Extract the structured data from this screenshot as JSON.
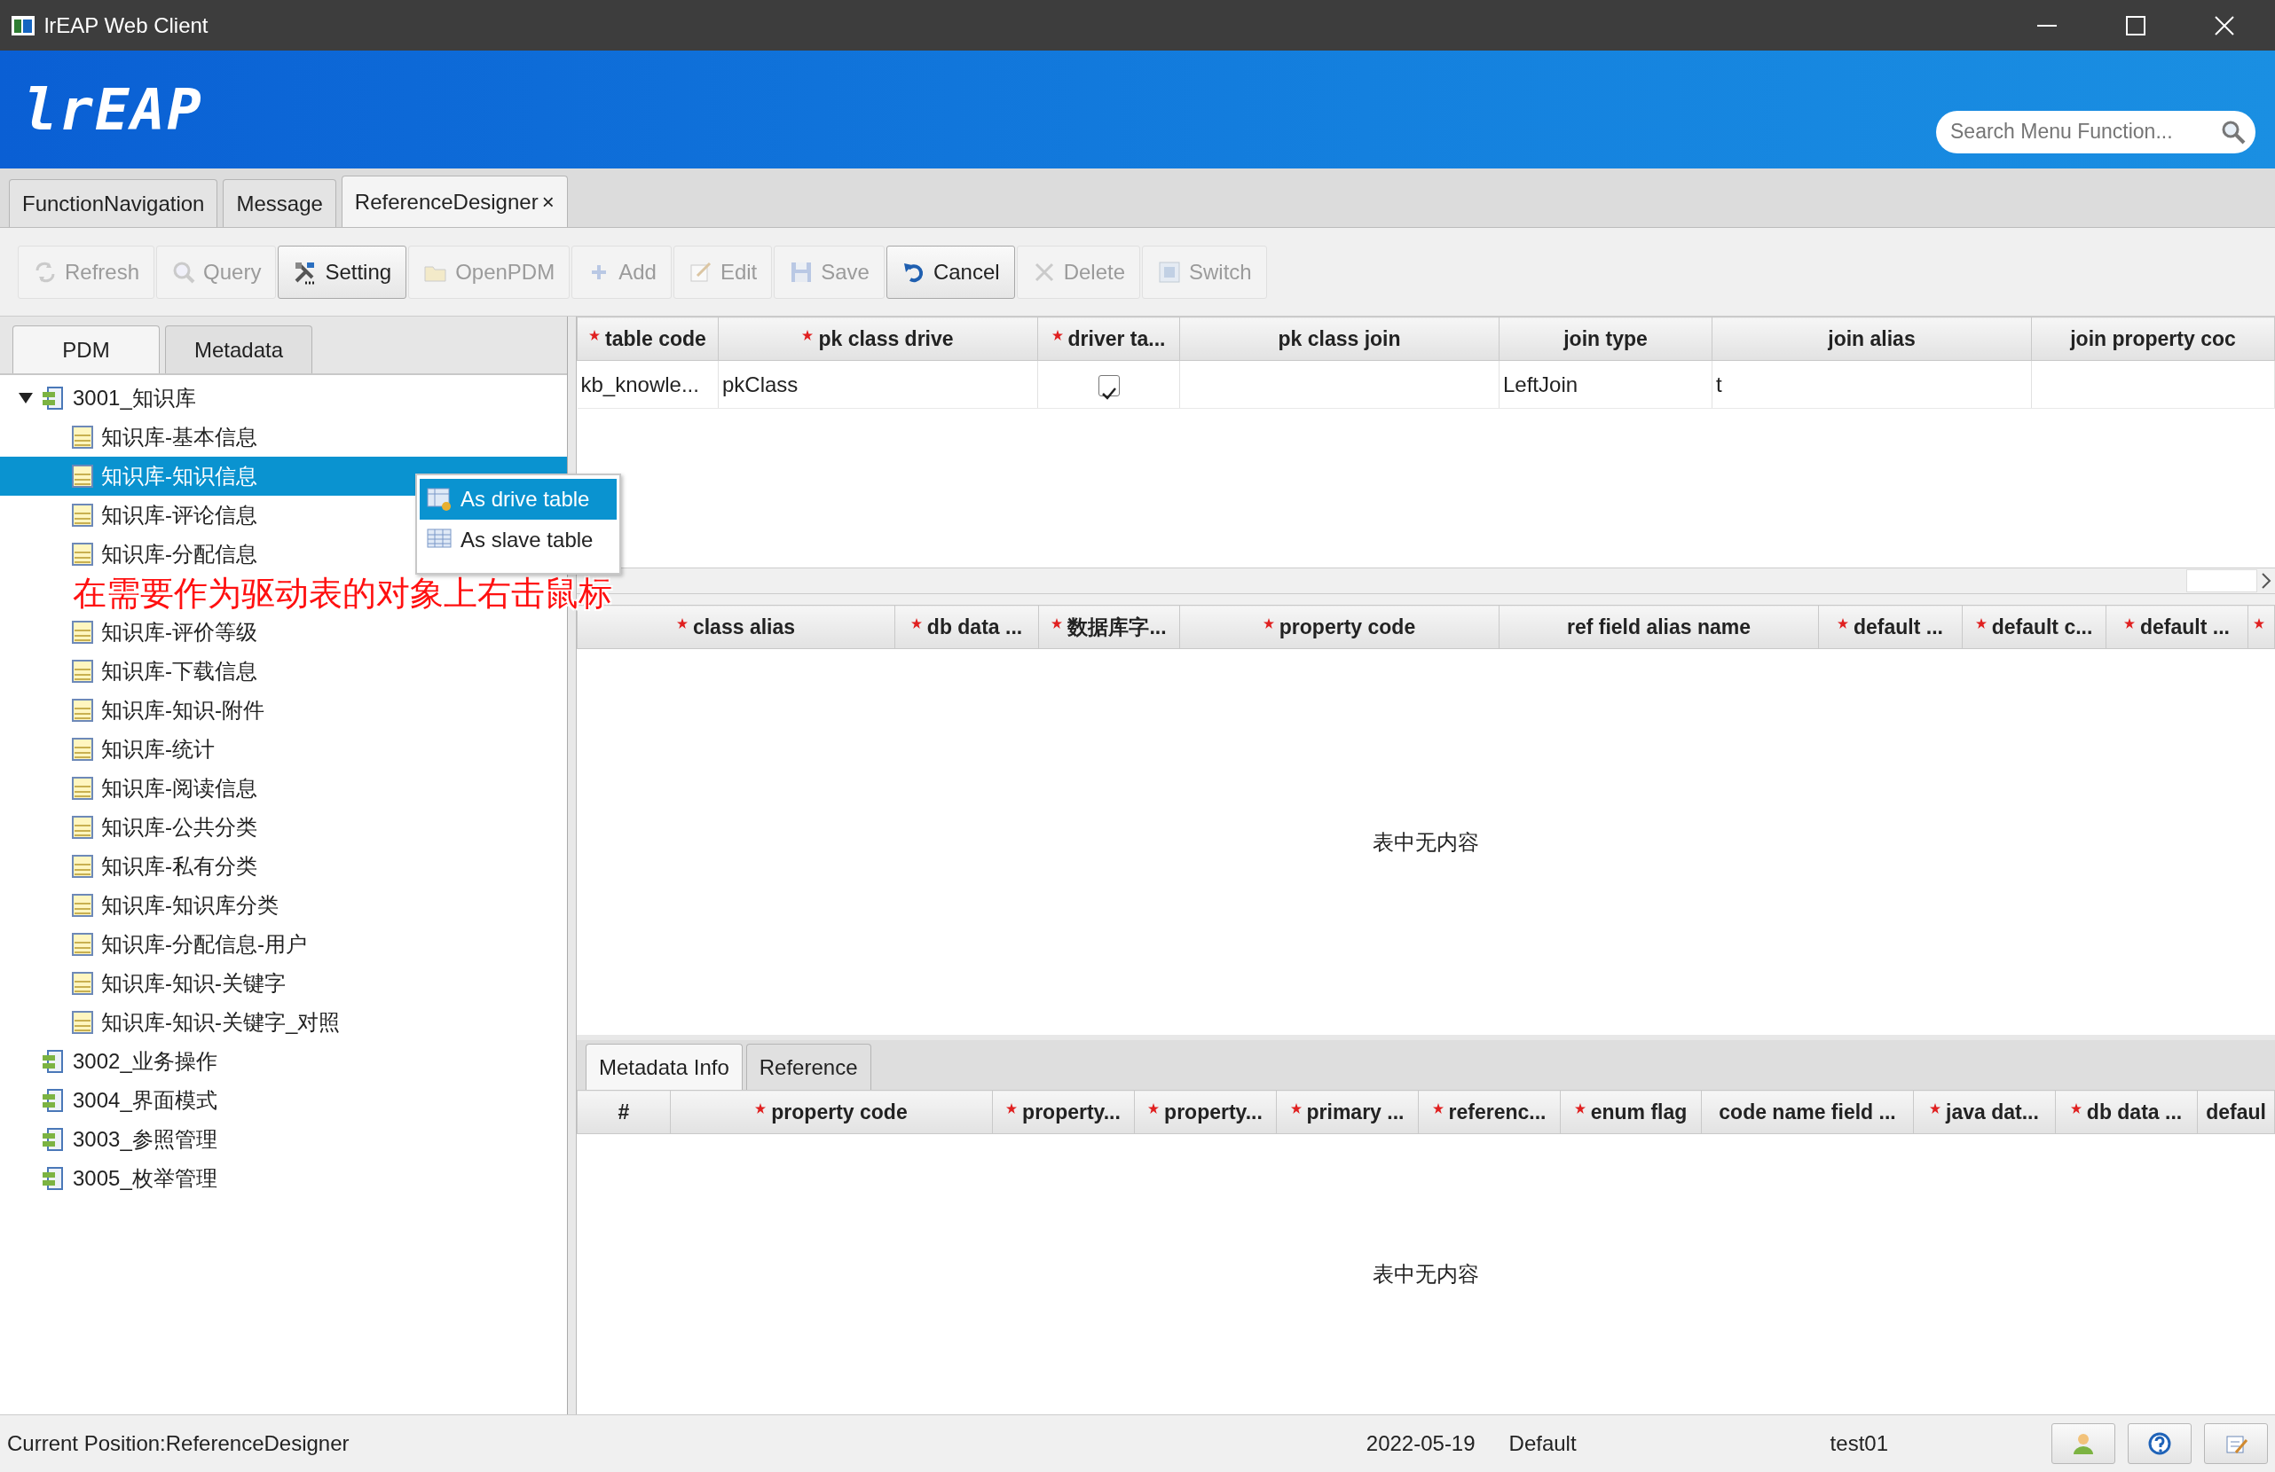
{
  "window": {
    "title": "lrEAP Web Client"
  },
  "header": {
    "logo": "lrEAP",
    "search": {
      "placeholder": "Search Menu Function..."
    }
  },
  "tabs": [
    {
      "label": "FunctionNavigation",
      "selected": false,
      "closable": false
    },
    {
      "label": "Message",
      "selected": false,
      "closable": false
    },
    {
      "label": "ReferenceDesigner",
      "selected": true,
      "closable": true,
      "close": "×"
    }
  ],
  "toolbar": [
    {
      "label": "Refresh",
      "kind": "refresh",
      "disabled": true
    },
    {
      "label": "Query",
      "kind": "query",
      "disabled": true
    },
    {
      "label": "Setting",
      "kind": "setting",
      "disabled": false
    },
    {
      "label": "OpenPDM",
      "kind": "open",
      "disabled": true
    },
    {
      "label": "Add",
      "kind": "add",
      "disabled": true
    },
    {
      "label": "Edit",
      "kind": "edit",
      "disabled": true
    },
    {
      "label": "Save",
      "kind": "save",
      "disabled": true
    },
    {
      "label": "Cancel",
      "kind": "cancel",
      "disabled": false
    },
    {
      "label": "Delete",
      "kind": "delete",
      "disabled": true
    },
    {
      "label": "Switch",
      "kind": "switch",
      "disabled": true
    }
  ],
  "left_tabs": [
    {
      "label": "PDM",
      "selected": true
    },
    {
      "label": "Metadata",
      "selected": false
    }
  ],
  "tree": [
    {
      "label": "3001_知识库",
      "expanded": true,
      "children": [
        {
          "kind": "table",
          "label": "知识库-基本信息",
          "selected": false
        },
        {
          "kind": "table",
          "label": "知识库-知识信息",
          "selected": true
        },
        {
          "kind": "table",
          "label": "知识库-评论信息",
          "selected": false
        },
        {
          "kind": "table",
          "label": "知识库-分配信息",
          "selected": false
        },
        {
          "kind": "annotation",
          "label": "在需要作为驱动表的对象上右击鼠标"
        },
        {
          "kind": "table",
          "label": "知识库-评价等级",
          "selected": false
        },
        {
          "kind": "table",
          "label": "知识库-下载信息",
          "selected": false
        },
        {
          "kind": "table",
          "label": "知识库-知识-附件",
          "selected": false
        },
        {
          "kind": "table",
          "label": "知识库-统计",
          "selected": false
        },
        {
          "kind": "table",
          "label": "知识库-阅读信息",
          "selected": false
        },
        {
          "kind": "table",
          "label": "知识库-公共分类",
          "selected": false
        },
        {
          "kind": "table",
          "label": "知识库-私有分类",
          "selected": false
        },
        {
          "kind": "table",
          "label": "知识库-知识库分类",
          "selected": false
        },
        {
          "kind": "table",
          "label": "知识库-分配信息-用户",
          "selected": false
        },
        {
          "kind": "table",
          "label": "知识库-知识-关键字",
          "selected": false
        },
        {
          "kind": "table",
          "label": "知识库-知识-关键字_对照",
          "selected": false
        }
      ]
    },
    {
      "label": "3002_业务操作",
      "expanded": false
    },
    {
      "label": "3004_界面模式",
      "expanded": false
    },
    {
      "label": "3003_参照管理",
      "expanded": false
    },
    {
      "label": "3005_枚举管理",
      "expanded": false
    }
  ],
  "context_menu": [
    {
      "label": "As drive table",
      "kind": "drive",
      "selected": true
    },
    {
      "label": "As slave table",
      "kind": "slave",
      "selected": false
    }
  ],
  "join_table": {
    "columns": [
      {
        "label": "table code",
        "required": true
      },
      {
        "label": "pk class drive",
        "required": true
      },
      {
        "label": "driver ta...",
        "required": true
      },
      {
        "label": "pk class join",
        "required": false
      },
      {
        "label": "join type",
        "required": false
      },
      {
        "label": "join alias",
        "required": false
      },
      {
        "label": "join property coc",
        "required": false
      }
    ],
    "rows": [
      [
        {
          "kind": "text",
          "text": "kb_knowle..."
        },
        {
          "kind": "text",
          "text": "pkClass"
        },
        {
          "kind": "checkbox",
          "checked": true
        },
        {
          "kind": "text",
          "text": ""
        },
        {
          "kind": "text",
          "text": "LeftJoin"
        },
        {
          "kind": "text",
          "text": "t"
        },
        {
          "kind": "text",
          "text": ""
        }
      ]
    ]
  },
  "field_table": {
    "columns": [
      {
        "label": "class alias",
        "required": true
      },
      {
        "label": "db data ...",
        "required": true
      },
      {
        "label": "数据库字...",
        "required": true
      },
      {
        "label": "property code",
        "required": true
      },
      {
        "label": "ref field alias name",
        "required": false
      },
      {
        "label": "default ...",
        "required": true
      },
      {
        "label": "default c...",
        "required": true
      },
      {
        "label": "default ...",
        "required": true
      },
      {
        "required": true
      }
    ],
    "empty_text": "表中无内容"
  },
  "bottom_tabs": [
    {
      "label": "Metadata Info",
      "selected": true
    },
    {
      "label": "Reference",
      "selected": false
    }
  ],
  "metadata_table": {
    "columns": [
      {
        "label": "#",
        "required": false
      },
      {
        "label": "property code",
        "required": true
      },
      {
        "label": "property...",
        "required": true
      },
      {
        "label": "property...",
        "required": true
      },
      {
        "label": "primary ...",
        "required": true
      },
      {
        "label": "referenc...",
        "required": true
      },
      {
        "label": "enum flag",
        "required": true
      },
      {
        "label": "code name field ...",
        "required": false
      },
      {
        "label": "java dat...",
        "required": true
      },
      {
        "label": "db data ...",
        "required": true
      },
      {
        "label": "defaul",
        "required": false
      }
    ],
    "empty_text": "表中无内容"
  },
  "status_bar": {
    "position": "Current Position:ReferenceDesigner",
    "date": "2022-05-19",
    "theme": "Default",
    "user": "test01"
  }
}
